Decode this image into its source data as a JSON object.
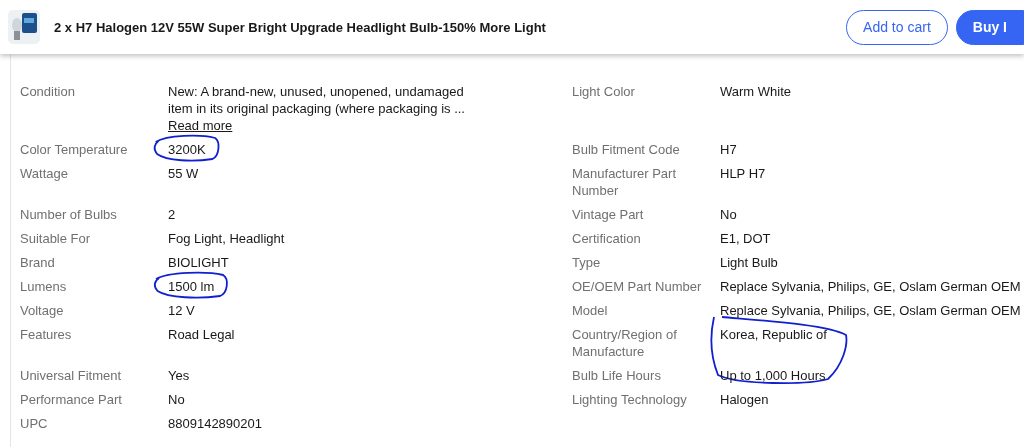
{
  "header": {
    "title": "2 x H7 Halogen 12V 55W Super Bright Upgrade Headlight Bulb-150% More Light",
    "buttons": [
      {
        "label": "Add to cart",
        "kind": "outline"
      },
      {
        "label": "Buy I",
        "kind": "primary"
      }
    ]
  },
  "specifics": [
    {
      "left": {
        "label": "Condition",
        "value": "New: A brand-new, unused, unopened, undamaged item in its original packaging (where packaging is ...",
        "link": "Read more"
      },
      "right": {
        "label": "Light Color",
        "value": "Warm White"
      }
    },
    {
      "left": {
        "label": "Color Temperature",
        "value": "3200K",
        "circled": true
      },
      "right": {
        "label": "Bulb Fitment Code",
        "value": "H7"
      }
    },
    {
      "left": {
        "label": "Wattage",
        "value": "55 W"
      },
      "right": {
        "label": "Manufacturer Part Number",
        "value": "HLP H7"
      }
    },
    {
      "left": {
        "label": "Number of Bulbs",
        "value": "2"
      },
      "right": {
        "label": "Vintage Part",
        "value": "No"
      }
    },
    {
      "left": {
        "label": "Suitable For",
        "value": "Fog Light, Headlight"
      },
      "right": {
        "label": "Certification",
        "value": "E1, DOT"
      }
    },
    {
      "left": {
        "label": "Brand",
        "value": "BIOLIGHT"
      },
      "right": {
        "label": "Type",
        "value": "Light Bulb"
      }
    },
    {
      "left": {
        "label": "Lumens",
        "value": "1500 lm",
        "circled": true
      },
      "right": {
        "label": "OE/OEM Part Number",
        "value": "Replace Sylvania, Philips, GE, Oslam German OEM"
      }
    },
    {
      "left": {
        "label": "Voltage",
        "value": "12 V"
      },
      "right": {
        "label": "Model",
        "value": "Replace Sylvania, Philips, GE, Oslam German OEM"
      }
    },
    {
      "left": {
        "label": "Features",
        "value": "Road Legal"
      },
      "right": {
        "label": "Country/Region of Manufacture",
        "value": "Korea, Republic of",
        "circled": true
      }
    },
    {
      "left": {
        "label": "Universal Fitment",
        "value": "Yes"
      },
      "right": {
        "label": "Bulb Life Hours",
        "value": "Up to 1,000 Hours"
      }
    },
    {
      "left": {
        "label": "Performance Part",
        "value": "No"
      },
      "right": {
        "label": "Lighting Technology",
        "value": "Halogen"
      }
    },
    {
      "left": {
        "label": "UPC",
        "value": "8809142890201"
      }
    }
  ]
}
